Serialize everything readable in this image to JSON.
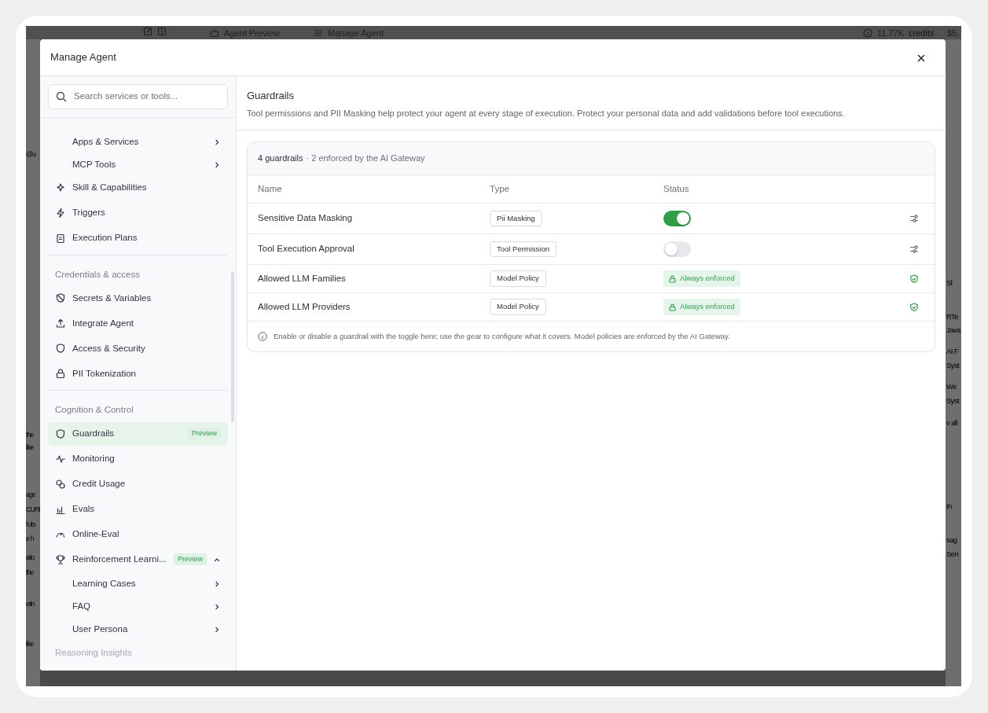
{
  "background": {
    "top_bar": {
      "agent_preview": "Agent Preview",
      "manage_agent": "Manage Agent",
      "credits": "11.77K",
      "credits_unit": "credits",
      "price": "$5."
    },
    "left_fragments": [
      "@u",
      "the",
      "like",
      "age",
      "CURI",
      "h its",
      "e h",
      "atio",
      "the",
      "etin",
      "like"
    ],
    "right_fragments": [
      "Sl",
      "RTe",
      "Java",
      "AI F",
      "Syst",
      "We",
      "Syst",
      "v all",
      "In",
      "sag",
      "Sen"
    ]
  },
  "modal": {
    "title": "Manage Agent"
  },
  "sidebar": {
    "search": {
      "placeholder": "Search services or tools..."
    },
    "sections": [
      {
        "items": [
          {
            "kind": "sub",
            "label": "Apps & Services",
            "selected": false,
            "disabled": false
          },
          {
            "kind": "sub",
            "label": "MCP Tools",
            "selected": false,
            "disabled": false
          },
          {
            "kind": "item",
            "label": "Skill & Capabilities",
            "selected": false,
            "disabled": false
          },
          {
            "kind": "item",
            "label": "Triggers",
            "selected": false,
            "disabled": false
          },
          {
            "kind": "item",
            "label": "Execution Plans",
            "selected": false,
            "disabled": false
          }
        ]
      },
      {
        "label": "Credentials & access",
        "items": [
          {
            "kind": "item",
            "label": "Secrets & Variables",
            "selected": false,
            "disabled": false
          },
          {
            "kind": "item",
            "label": "Integrate Agent",
            "selected": false,
            "disabled": false
          },
          {
            "kind": "item",
            "label": "Access & Security",
            "selected": false,
            "disabled": false
          },
          {
            "kind": "item",
            "label": "PII Tokenization",
            "selected": false,
            "disabled": false
          }
        ]
      },
      {
        "label": "Cognition & Control",
        "items": [
          {
            "kind": "item",
            "label": "Guardrails",
            "badge": "Preview",
            "selected": true,
            "disabled": false
          },
          {
            "kind": "item",
            "label": "Monitoring",
            "selected": false,
            "disabled": false
          },
          {
            "kind": "item",
            "label": "Credit Usage",
            "selected": false,
            "disabled": false
          },
          {
            "kind": "item",
            "label": "Evals",
            "selected": false,
            "disabled": false
          },
          {
            "kind": "item",
            "label": "Online-Eval",
            "selected": false,
            "disabled": false
          },
          {
            "kind": "item",
            "label": "Reinforcement Learni...",
            "badge": "Preview",
            "selected": false,
            "disabled": false,
            "expanded": true,
            "children": [
              {
                "kind": "sub",
                "label": "Learning Cases",
                "selected": false,
                "disabled": false
              },
              {
                "kind": "sub",
                "label": "FAQ",
                "selected": false,
                "disabled": false
              },
              {
                "kind": "sub",
                "label": "User Persona",
                "selected": false,
                "disabled": false
              }
            ]
          },
          {
            "kind": "item",
            "label": "Reasoning Insights",
            "selected": false,
            "disabled": true
          }
        ]
      }
    ]
  },
  "content": {
    "title": "Guardrails",
    "description": "Tool permissions and PII Masking help protect your agent at every stage of execution. Protect your personal data and add validations before tool executions.",
    "summary": {
      "count": "4 guardrails",
      "detail": "· 2 enforced by the AI Gateway"
    },
    "table": {
      "columns": [
        "Name",
        "Type",
        "Status"
      ],
      "rows": [
        {
          "kind": "toggle",
          "name": "Sensitive Data Masking",
          "type": "Pii Masking",
          "on": true
        },
        {
          "kind": "toggle",
          "name": "Tool Execution Approval",
          "type": "Tool Permission",
          "on": false
        },
        {
          "kind": "enforced",
          "name": "Allowed LLM Families",
          "type": "Model Policy",
          "status": "Always enforced"
        },
        {
          "kind": "enforced",
          "name": "Allowed LLM Providers",
          "type": "Model Policy",
          "status": "Always enforced"
        }
      ]
    },
    "note": "Enable or disable a guardrail with the toggle here; use the gear to configure what it covers. Model policies are enforced by the AI Gateway."
  }
}
